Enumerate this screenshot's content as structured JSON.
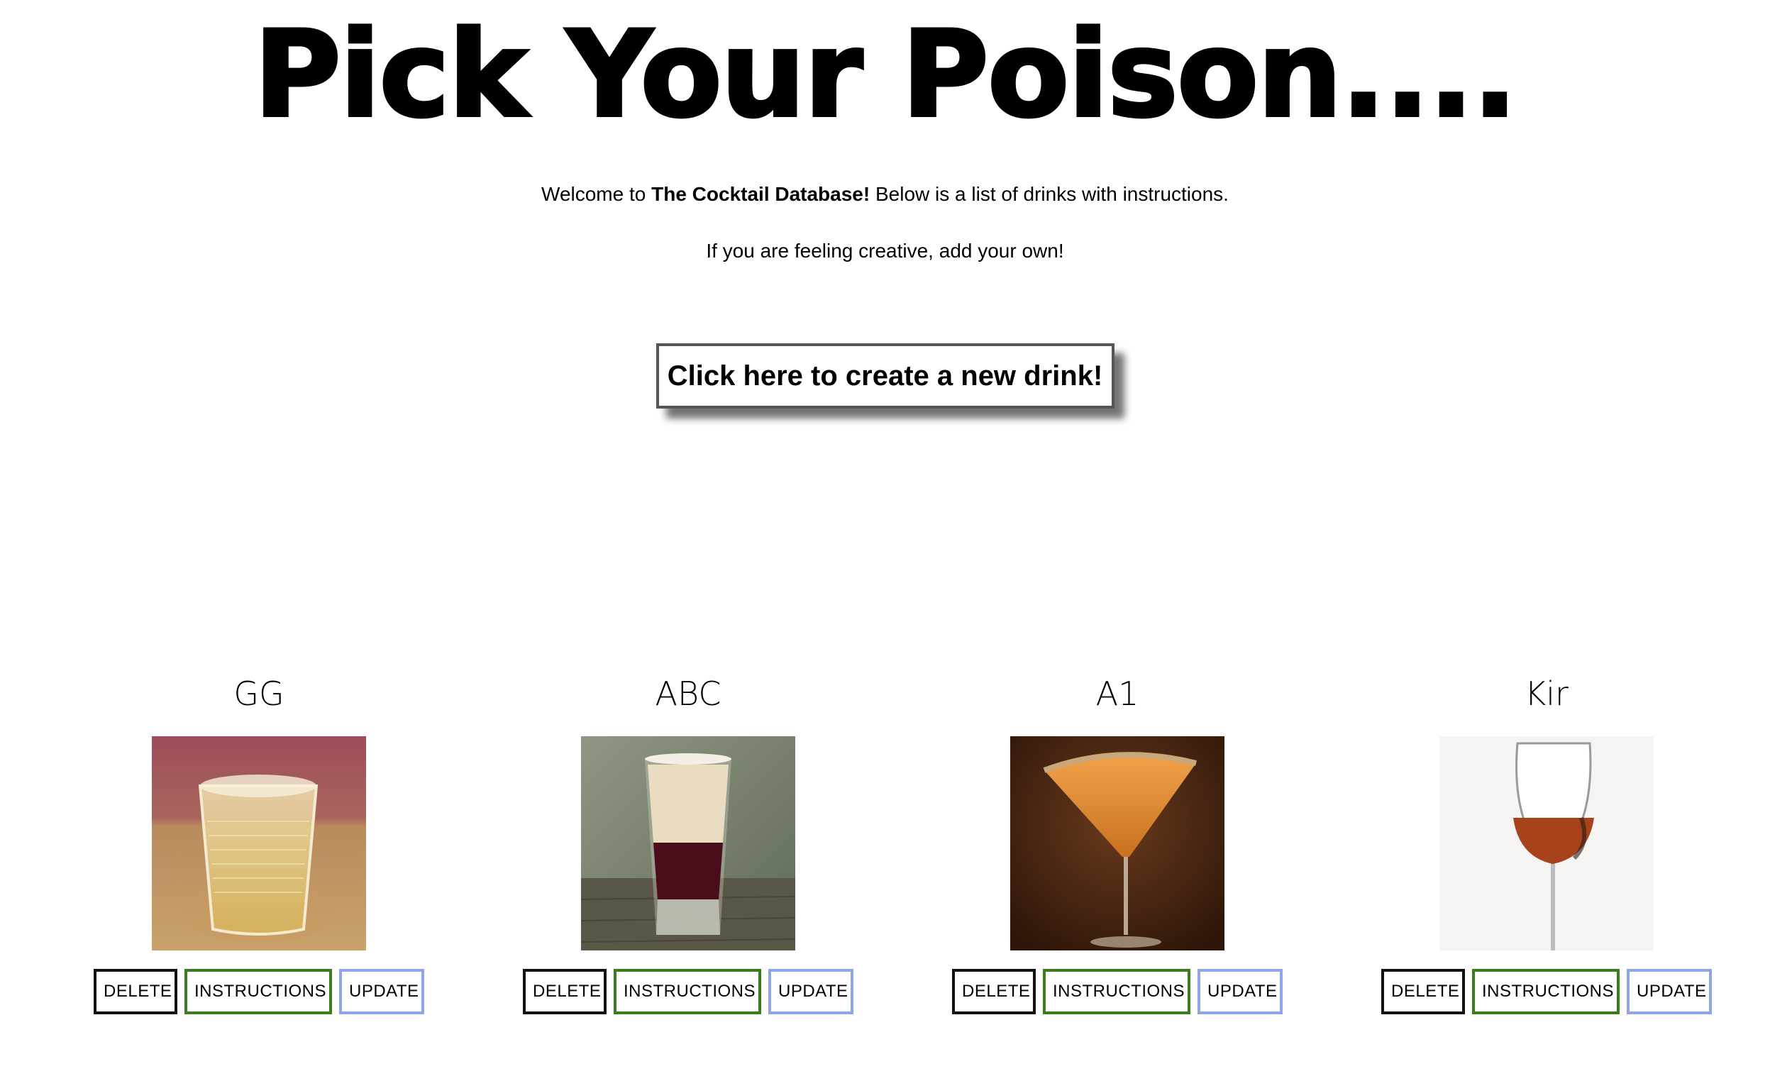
{
  "header": {
    "title": "Pick Your Poison...."
  },
  "intro": {
    "line1_prefix": "Welcome to ",
    "line1_bold": "The Cocktail Database!",
    "line1_suffix": " Below is a list of drinks with instructions.",
    "line2": "If you are feeling creative, add your own!"
  },
  "create_button": {
    "label": "Click here to create a new drink!"
  },
  "drinks": [
    {
      "name": "GG",
      "delete_label": "DELETE",
      "instructions_label": "INSTRUCTIONS",
      "update_label": "UPDATE"
    },
    {
      "name": "ABC",
      "delete_label": "DELETE",
      "instructions_label": "INSTRUCTIONS",
      "update_label": "UPDATE"
    },
    {
      "name": "A1",
      "delete_label": "DELETE",
      "instructions_label": "INSTRUCTIONS",
      "update_label": "UPDATE"
    },
    {
      "name": "Kir",
      "delete_label": "DELETE",
      "instructions_label": "INSTRUCTIONS",
      "update_label": "UPDATE"
    }
  ],
  "colors": {
    "delete_border": "#111111",
    "instructions_border": "#3a7d1e",
    "update_border": "#8ea4e6"
  }
}
